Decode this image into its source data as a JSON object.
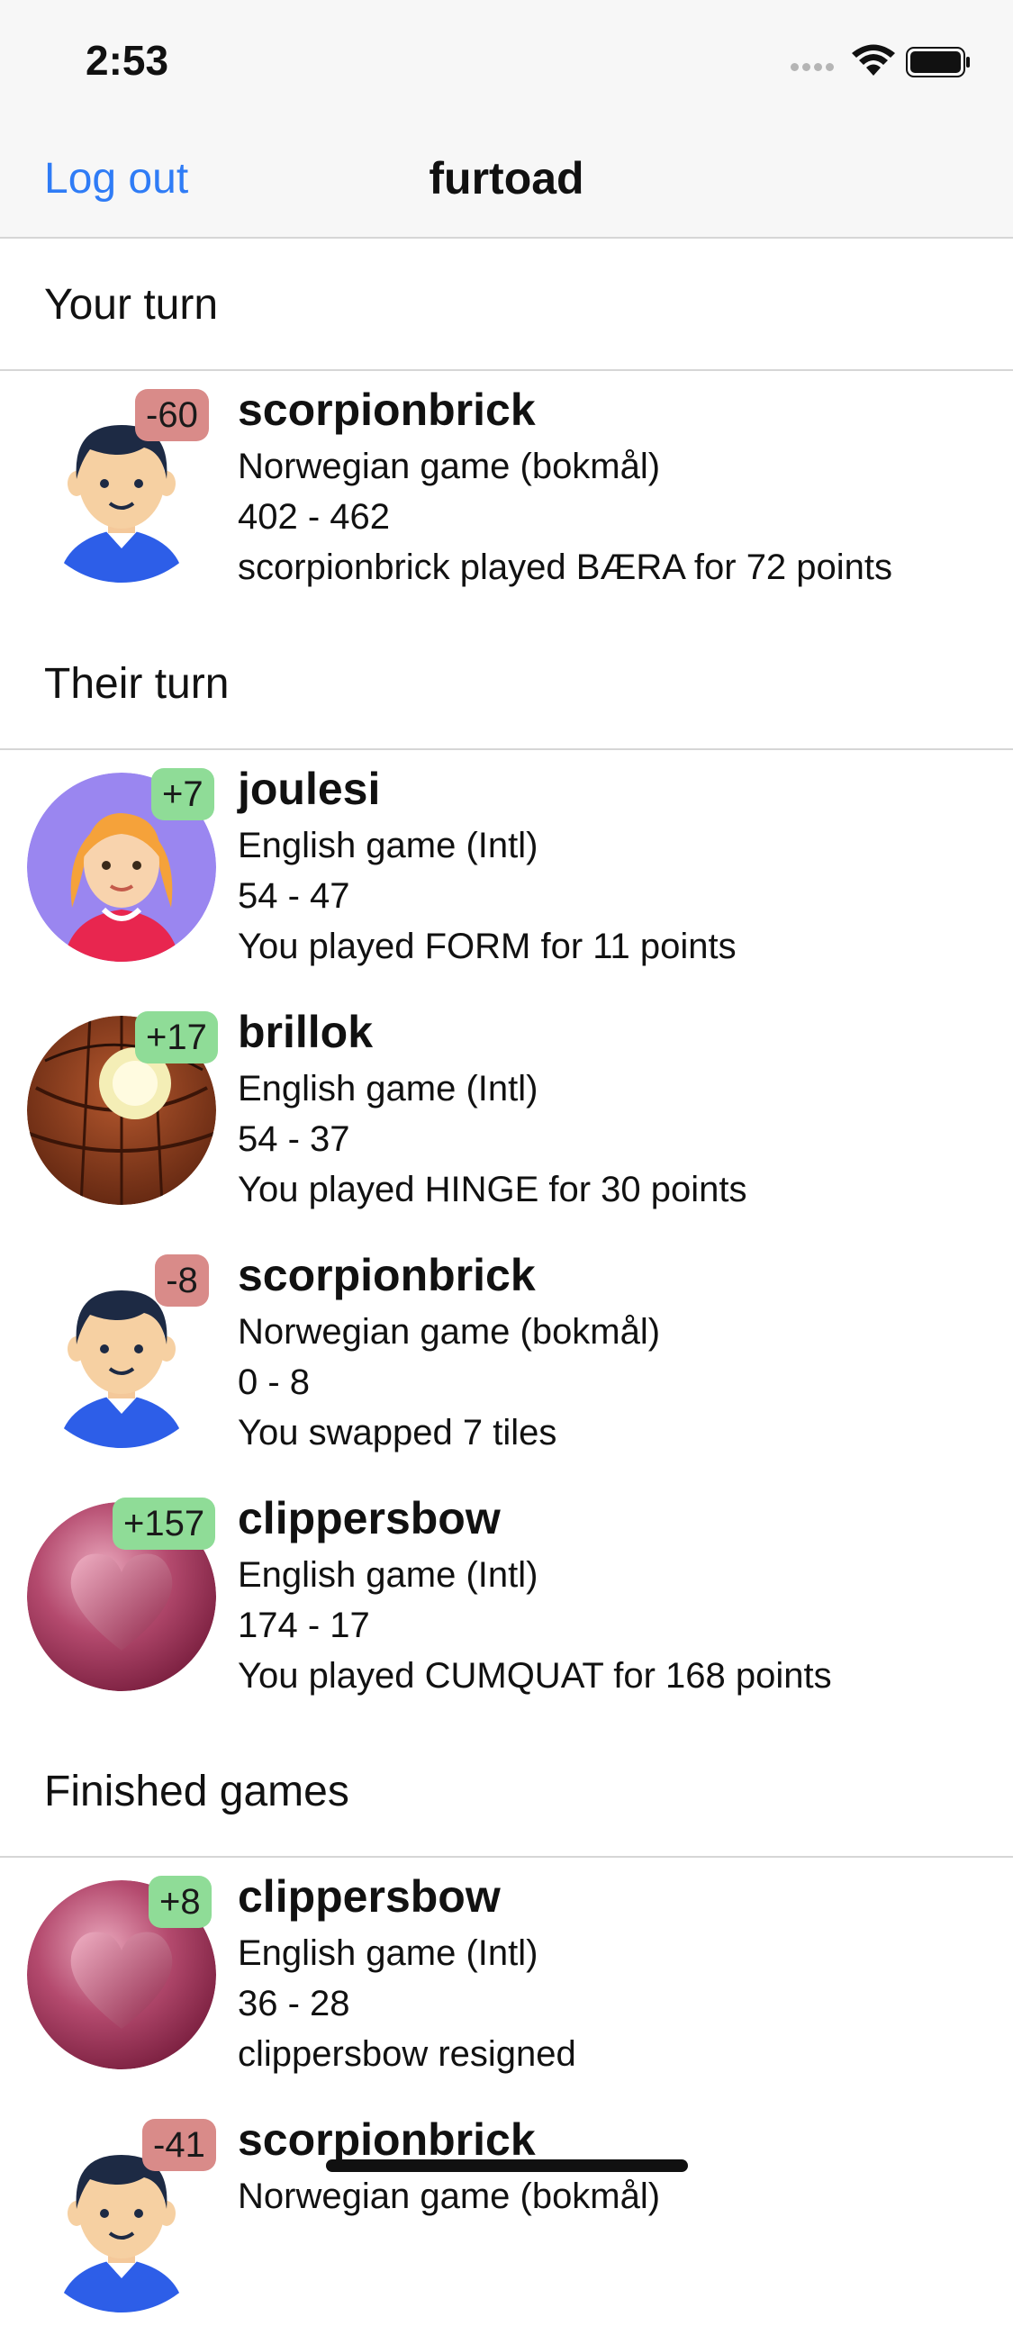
{
  "status": {
    "time": "2:53"
  },
  "nav": {
    "logout_label": "Log out",
    "title": "furtoad"
  },
  "sections": {
    "your_turn": "Your turn",
    "their_turn": "Their turn",
    "finished": "Finished games"
  },
  "your_turn_games": [
    {
      "name": "scorpionbrick",
      "badge": "-60",
      "language": "Norwegian game (bokmål)",
      "score": "402 - 462",
      "last_move": "scorpionbrick played BÆRA for 72 points",
      "avatar": "boy-avatar"
    }
  ],
  "their_turn_games": [
    {
      "name": "joulesi",
      "badge": "+7",
      "language": "English game (Intl)",
      "score": "54 - 47",
      "last_move": "You played FORM for 11 points",
      "avatar": "girl-avatar"
    },
    {
      "name": "brillok",
      "badge": "+17",
      "language": "English game (Intl)",
      "score": "54 - 37",
      "last_move": "You played HINGE for 30 points",
      "avatar": "lamp-avatar"
    },
    {
      "name": "scorpionbrick",
      "badge": "-8",
      "language": "Norwegian game (bokmål)",
      "score": "0 - 8",
      "last_move": "You swapped 7 tiles",
      "avatar": "boy-avatar"
    },
    {
      "name": "clippersbow",
      "badge": "+157",
      "language": "English game (Intl)",
      "score": "174 - 17",
      "last_move": "You played CUMQUAT for 168 points",
      "avatar": "heart-avatar"
    }
  ],
  "finished_games": [
    {
      "name": "clippersbow",
      "badge": "+8",
      "language": "English game (Intl)",
      "score": "36 - 28",
      "last_move": "clippersbow resigned",
      "avatar": "heart-avatar"
    },
    {
      "name": "scorpionbrick",
      "badge": "-41",
      "language": "Norwegian game (bokmål)",
      "avatar": "boy-avatar"
    }
  ],
  "colors": {
    "accent": "#2f7cf6",
    "badge_negative": "#d98b89",
    "badge_positive": "#8fdc97"
  }
}
